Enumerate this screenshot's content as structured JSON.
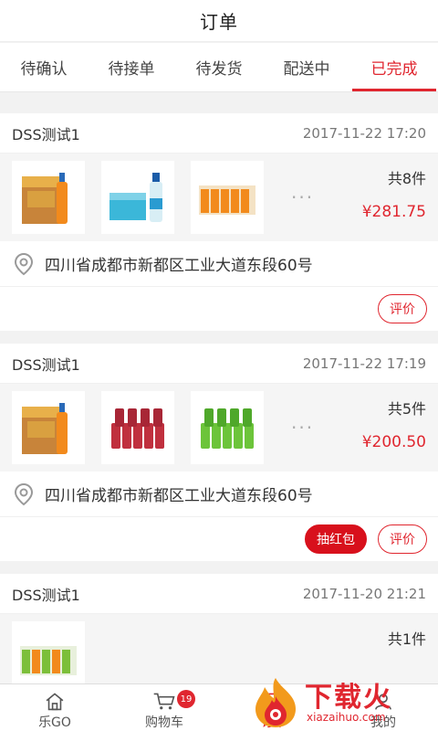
{
  "header": {
    "title": "订单"
  },
  "tabs": [
    {
      "label": "待确认"
    },
    {
      "label": "待接单"
    },
    {
      "label": "待发货"
    },
    {
      "label": "配送中"
    },
    {
      "label": "已完成"
    }
  ],
  "active_tab": "已完成",
  "accent_color": "#e0262f",
  "orders": [
    {
      "store": "DSS测试1",
      "time": "2017-11-22 17:20",
      "count": "共8件",
      "price": "¥281.75",
      "address": "四川省成都市新都区工业大道东段60号",
      "products": [
        "juice-box-product",
        "milk-drink-product",
        "juice-pack-product"
      ],
      "more": "···",
      "buttons": {
        "review": "评价"
      }
    },
    {
      "store": "DSS测试1",
      "time": "2017-11-22 17:19",
      "count": "共5件",
      "price": "¥200.50",
      "address": "四川省成都市新都区工业大道东段60号",
      "products": [
        "juice-box-product",
        "red-bottles-product",
        "green-bottles-product"
      ],
      "more": "···",
      "buttons": {
        "redpacket": "抽红包",
        "review": "评价"
      }
    },
    {
      "store": "DSS测试1",
      "time": "2017-11-20 21:21",
      "count": "共1件",
      "products": [
        "juice-pack-product"
      ]
    }
  ],
  "bottom_nav": {
    "home": "乐GO",
    "cart": "购物车",
    "cart_badge": "19",
    "orders": "订单",
    "mine": "我的"
  },
  "watermark": {
    "text": "下载火",
    "sub": "xiazaihuo.com"
  }
}
